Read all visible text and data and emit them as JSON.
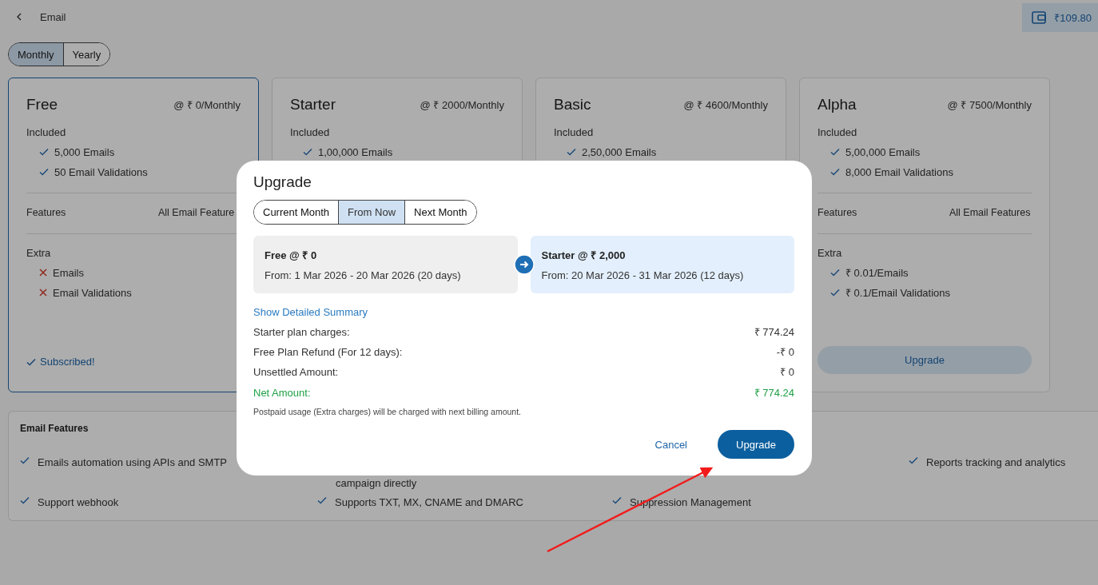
{
  "header": {
    "title": "Email",
    "wallet": "₹109.80"
  },
  "billing_toggle": [
    {
      "label": "Monthly",
      "selected": true
    },
    {
      "label": "Yearly",
      "selected": false
    }
  ],
  "plans": [
    {
      "name": "Free",
      "price": "@ ₹ 0/Monthly",
      "current": true,
      "included_label": "Included",
      "included": [
        "5,000 Emails",
        "50 Email Validations"
      ],
      "features_label": "Features",
      "features_value": "All Email Feature",
      "extra_label": "Extra",
      "extra": [
        {
          "label": "Emails",
          "included": false
        },
        {
          "label": "Email Validations",
          "included": false
        }
      ],
      "action": {
        "kind": "status",
        "label": "Subscribed!"
      }
    },
    {
      "name": "Starter",
      "price": "@ ₹ 2000/Monthly",
      "current": false,
      "included_label": "Included",
      "included": [
        "1,00,000 Emails"
      ]
    },
    {
      "name": "Basic",
      "price": "@ ₹ 4600/Monthly",
      "current": false,
      "included_label": "Included",
      "included": [
        "2,50,000 Emails"
      ]
    },
    {
      "name": "Alpha",
      "price": "@ ₹ 7500/Monthly",
      "current": false,
      "included_label": "Included",
      "included": [
        "5,00,000 Emails",
        "8,000 Email Validations"
      ],
      "features_label": "Features",
      "features_value": "All Email Features",
      "extra_label": "Extra",
      "extra": [
        {
          "label": "₹ 0.01/Emails",
          "included": true
        },
        {
          "label": "₹ 0.1/Email Validations",
          "included": true
        }
      ],
      "action": {
        "kind": "button",
        "label": "Upgrade"
      }
    }
  ],
  "email_features": {
    "title": "Email Features",
    "rows": [
      [
        {
          "kind": "item",
          "label": "Emails automation using APIs and SMTP"
        },
        {
          "kind": "continuation",
          "label": "campaign directly"
        },
        {
          "kind": "blank"
        },
        {
          "kind": "item",
          "label": "Reports tracking and analytics"
        }
      ],
      [
        {
          "kind": "item",
          "label": "Support webhook"
        },
        {
          "kind": "item",
          "label": "Supports TXT, MX, CNAME and DMARC"
        },
        {
          "kind": "item",
          "label": "Suppression Management"
        },
        {
          "kind": "blank"
        }
      ]
    ]
  },
  "upgrade_dialog": {
    "title": "Upgrade",
    "tabs": [
      {
        "label": "Current Month",
        "selected": false
      },
      {
        "label": "From Now",
        "selected": true
      },
      {
        "label": "Next Month",
        "selected": false
      }
    ],
    "periods": [
      {
        "kind": "current",
        "plan": "Free @ ₹ 0",
        "range": "From: 1 Mar 2026 - 20 Mar 2026 (20 days)"
      },
      {
        "kind": "new",
        "plan": "Starter @ ₹ 2,000",
        "range": "From: 20 Mar 2026 - 31 Mar 2026 (12 days)"
      }
    ],
    "summary_link": "Show Detailed Summary",
    "summary": [
      {
        "kind": "line",
        "label": "Starter plan charges:",
        "value": "₹ 774.24"
      },
      {
        "kind": "line",
        "label": "Free Plan Refund (For 12 days):",
        "value": "-₹ 0"
      },
      {
        "kind": "line",
        "label": "Unsettled Amount:",
        "value": "₹ 0"
      },
      {
        "kind": "total",
        "label": "Net Amount:",
        "value": "₹ 774.24"
      }
    ],
    "note": "Postpaid usage (Extra charges) will be charged with next billing amount.",
    "buttons": [
      {
        "kind": "text",
        "label": "Cancel"
      },
      {
        "kind": "primary",
        "label": "Upgrade"
      }
    ]
  }
}
